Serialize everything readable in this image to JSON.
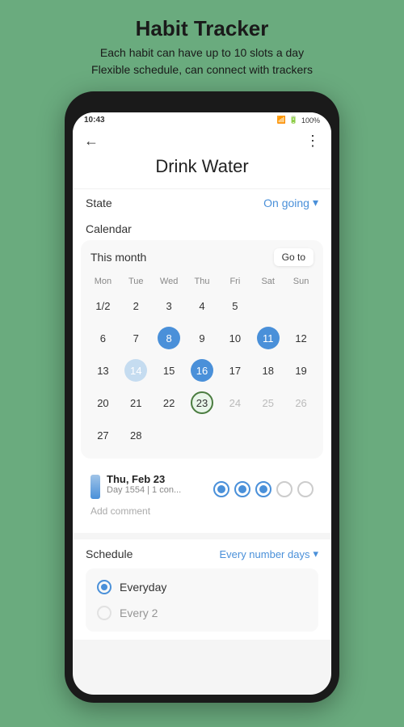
{
  "header": {
    "title": "Habit Tracker",
    "subtitle_line1": "Each habit can have up to 10 slots a day",
    "subtitle_line2": "Flexible schedule, can connect with trackers"
  },
  "status_bar": {
    "time": "10:43",
    "battery": "100%",
    "icons": "📶🔋"
  },
  "screen": {
    "title": "Drink Water",
    "back_label": "←",
    "menu_label": "⋮",
    "state_label": "State",
    "state_value": "On going",
    "calendar_label": "Calendar",
    "calendar": {
      "month_label": "This month",
      "goto_label": "Go to",
      "day_headers": [
        "Mon",
        "Tue",
        "Wed",
        "Thu",
        "Fri",
        "Sat",
        "Sun"
      ],
      "days": [
        {
          "label": "1⁄2",
          "type": "normal",
          "sub": ""
        },
        {
          "label": "2",
          "type": "normal"
        },
        {
          "label": "3",
          "type": "normal"
        },
        {
          "label": "4",
          "type": "normal"
        },
        {
          "label": "5",
          "type": "normal"
        },
        {
          "label": "6",
          "type": "normal"
        },
        {
          "label": "7",
          "type": "normal"
        },
        {
          "label": "8",
          "type": "filled"
        },
        {
          "label": "9",
          "type": "normal"
        },
        {
          "label": "10",
          "type": "normal"
        },
        {
          "label": "11",
          "type": "filled"
        },
        {
          "label": "12",
          "type": "normal"
        },
        {
          "label": "13",
          "type": "normal"
        },
        {
          "label": "14",
          "type": "light-fill"
        },
        {
          "label": "15",
          "type": "normal"
        },
        {
          "label": "16",
          "type": "filled"
        },
        {
          "label": "17",
          "type": "normal"
        },
        {
          "label": "18",
          "type": "normal"
        },
        {
          "label": "19",
          "type": "normal"
        },
        {
          "label": "20",
          "type": "normal"
        },
        {
          "label": "21",
          "type": "normal"
        },
        {
          "label": "22",
          "type": "normal"
        },
        {
          "label": "23",
          "type": "today"
        },
        {
          "label": "24",
          "type": "gray"
        },
        {
          "label": "25",
          "type": "gray"
        },
        {
          "label": "26",
          "type": "gray"
        },
        {
          "label": "27",
          "type": "normal"
        },
        {
          "label": "28",
          "type": "normal"
        }
      ]
    },
    "day_detail": {
      "date": "Thu, Feb 23",
      "meta": "Day 1554 | 1 con...",
      "dots": [
        "filled",
        "filled",
        "filled",
        "empty",
        "empty"
      ],
      "add_comment": "Add comment"
    },
    "schedule": {
      "label": "Schedule",
      "dropdown_label": "Every number days",
      "options": [
        {
          "label": "Everyday",
          "selected": true
        },
        {
          "label": "Every 2",
          "selected": false
        }
      ]
    }
  }
}
